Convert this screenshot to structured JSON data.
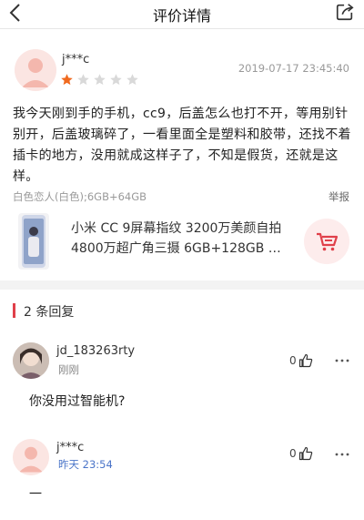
{
  "header": {
    "title": "评价详情",
    "back_icon": "chevron-left-icon",
    "share_icon": "share-icon"
  },
  "review": {
    "username": "j***c",
    "date": "2019-07-17 23:45:40",
    "rating": 1,
    "rating_max": 5,
    "text": "我今天刚到手的手机，cc9，后盖怎么也打不开，等用别针别开，后盖玻璃碎了，一看里面全是塑料和胶带，还找不着插卡的地方，没用就成这样子了，不知是假货，还就是这样。",
    "variant": "白色恋人(白色);6GB+64GB",
    "report_label": "举报"
  },
  "product": {
    "name_line1": "小米 CC 9屏幕指纹 3200万美颜自拍",
    "name_line2": "4800万超广角三摄 6GB+128GB 白...",
    "cart_icon": "cart-icon"
  },
  "replies": {
    "title": "2  条回复",
    "items": [
      {
        "username": "jd_183263rty",
        "time": "刚刚",
        "likes": "0",
        "text": "你没用过智能机?"
      },
      {
        "username": "j***c",
        "time": "昨天 23:54",
        "likes": "0",
        "text": "一"
      }
    ]
  },
  "colors": {
    "accent": "#e0404a",
    "star_active": "#f06a1f",
    "star_inactive": "#d9d9d9",
    "time_blue": "#4a74c8"
  }
}
